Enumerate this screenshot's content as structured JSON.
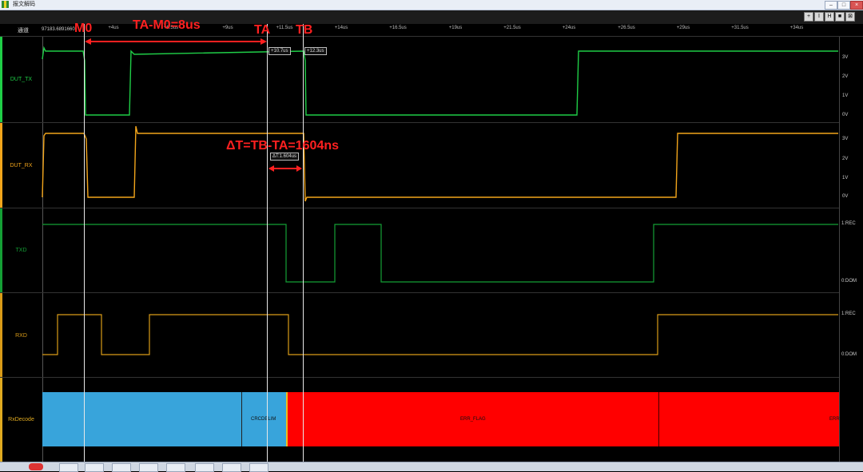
{
  "window": {
    "title": "报文解码"
  },
  "toolbar": {
    "buttons": [
      "+",
      "I",
      "H",
      "■",
      "⊠"
    ]
  },
  "axis": {
    "channel_header": "通道",
    "timestamp": "97183.6891660",
    "ticks": [
      "+4us",
      "+6.5us",
      "+9us",
      "+11.5us",
      "+14us",
      "+16.5us",
      "+19us",
      "+21.5us",
      "+24us",
      "+26.5us",
      "+29us",
      "+31.5us",
      "+34us"
    ]
  },
  "channels": [
    {
      "name": "DUT_TX",
      "color": "#1fce47",
      "scale": [
        "3V",
        "2V",
        "1V",
        "0V"
      ]
    },
    {
      "name": "DUT_RX",
      "color": "#f2a51b",
      "scale": [
        "3V",
        "2V",
        "1V",
        "0V"
      ]
    },
    {
      "name": "TXD",
      "color": "#149f35",
      "scale": [
        "1:REC",
        "0:DOM"
      ]
    },
    {
      "name": "RXD",
      "color": "#d99b18",
      "scale": [
        "1:REC",
        "0:DOM"
      ]
    },
    {
      "name": "RxDecode",
      "color": "#e0aa20"
    }
  ],
  "markers": {
    "ta_box": "+10.7us",
    "tb_box": "+12.3us",
    "delta_box": "ΔT:1.604us"
  },
  "annotations": {
    "m0": "M0",
    "ta_m0": "TA-M0=8us",
    "ta": "TA",
    "tb": "TB",
    "delta": "ΔT=TB-TA=1604ns"
  },
  "decode": {
    "crc_label": "CRCDELIM",
    "err_label": "ERR_FLAG",
    "err_label_trunc": "ERR",
    "colors": {
      "blue": "#38a4db",
      "red": "#ff0000"
    }
  }
}
